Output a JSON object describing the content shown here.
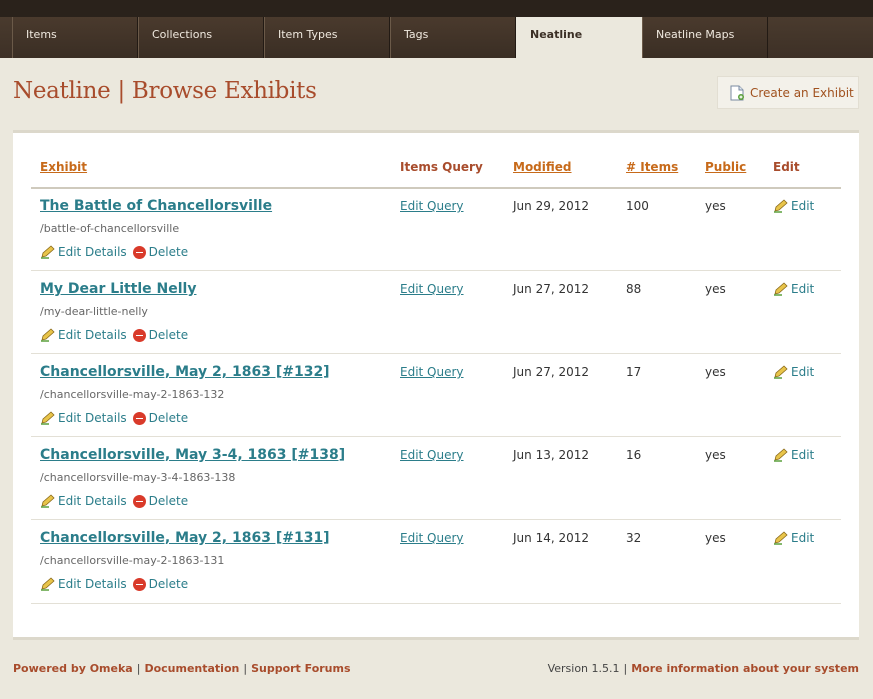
{
  "tabs": [
    {
      "label": "Items",
      "active": false
    },
    {
      "label": "Collections",
      "active": false
    },
    {
      "label": "Item Types",
      "active": false
    },
    {
      "label": "Tags",
      "active": false
    },
    {
      "label": "Neatline",
      "active": true
    },
    {
      "label": "Neatline Maps",
      "active": false
    }
  ],
  "page": {
    "title": "Neatline | Browse Exhibits",
    "create_label": "Create an Exhibit"
  },
  "table": {
    "headers": {
      "exhibit": "Exhibit",
      "items_query": "Items Query",
      "modified": "Modified",
      "items": "# Items",
      "public": "Public",
      "edit": "Edit"
    },
    "rows": [
      {
        "title": "The Battle of Chancellorsville",
        "slug": "/battle-of-chancellorsville",
        "query": "Edit Query",
        "modified": "Jun 29, 2012",
        "items": "100",
        "public": "yes"
      },
      {
        "title": "My Dear Little Nelly",
        "slug": "/my-dear-little-nelly",
        "query": "Edit Query",
        "modified": "Jun 27, 2012",
        "items": "88",
        "public": "yes"
      },
      {
        "title": "Chancellorsville, May 2, 1863 [#132]",
        "slug": "/chancellorsville-may-2-1863-132",
        "query": "Edit Query",
        "modified": "Jun 27, 2012",
        "items": "17",
        "public": "yes"
      },
      {
        "title": "Chancellorsville, May 3-4, 1863 [#138]",
        "slug": "/chancellorsville-may-3-4-1863-138",
        "query": "Edit Query",
        "modified": "Jun 13, 2012",
        "items": "16",
        "public": "yes"
      },
      {
        "title": "Chancellorsville, May 2, 1863 [#131]",
        "slug": "/chancellorsville-may-2-1863-131",
        "query": "Edit Query",
        "modified": "Jun 14, 2012",
        "items": "32",
        "public": "yes"
      }
    ],
    "edit_details_label": "Edit Details",
    "delete_label": "Delete",
    "edit_label": "Edit"
  },
  "footer": {
    "powered": "Powered by Omeka",
    "docs": "Documentation",
    "forums": "Support Forums",
    "version": "Version 1.5.1",
    "more_info": "More information about your system"
  },
  "colors": {
    "accent": "#a84c2c",
    "link": "#2b7d8a",
    "sort_header": "#c76a1a"
  },
  "icons": {
    "create": "new-document-icon",
    "edit": "pencil-icon",
    "delete": "delete-circle-icon"
  }
}
